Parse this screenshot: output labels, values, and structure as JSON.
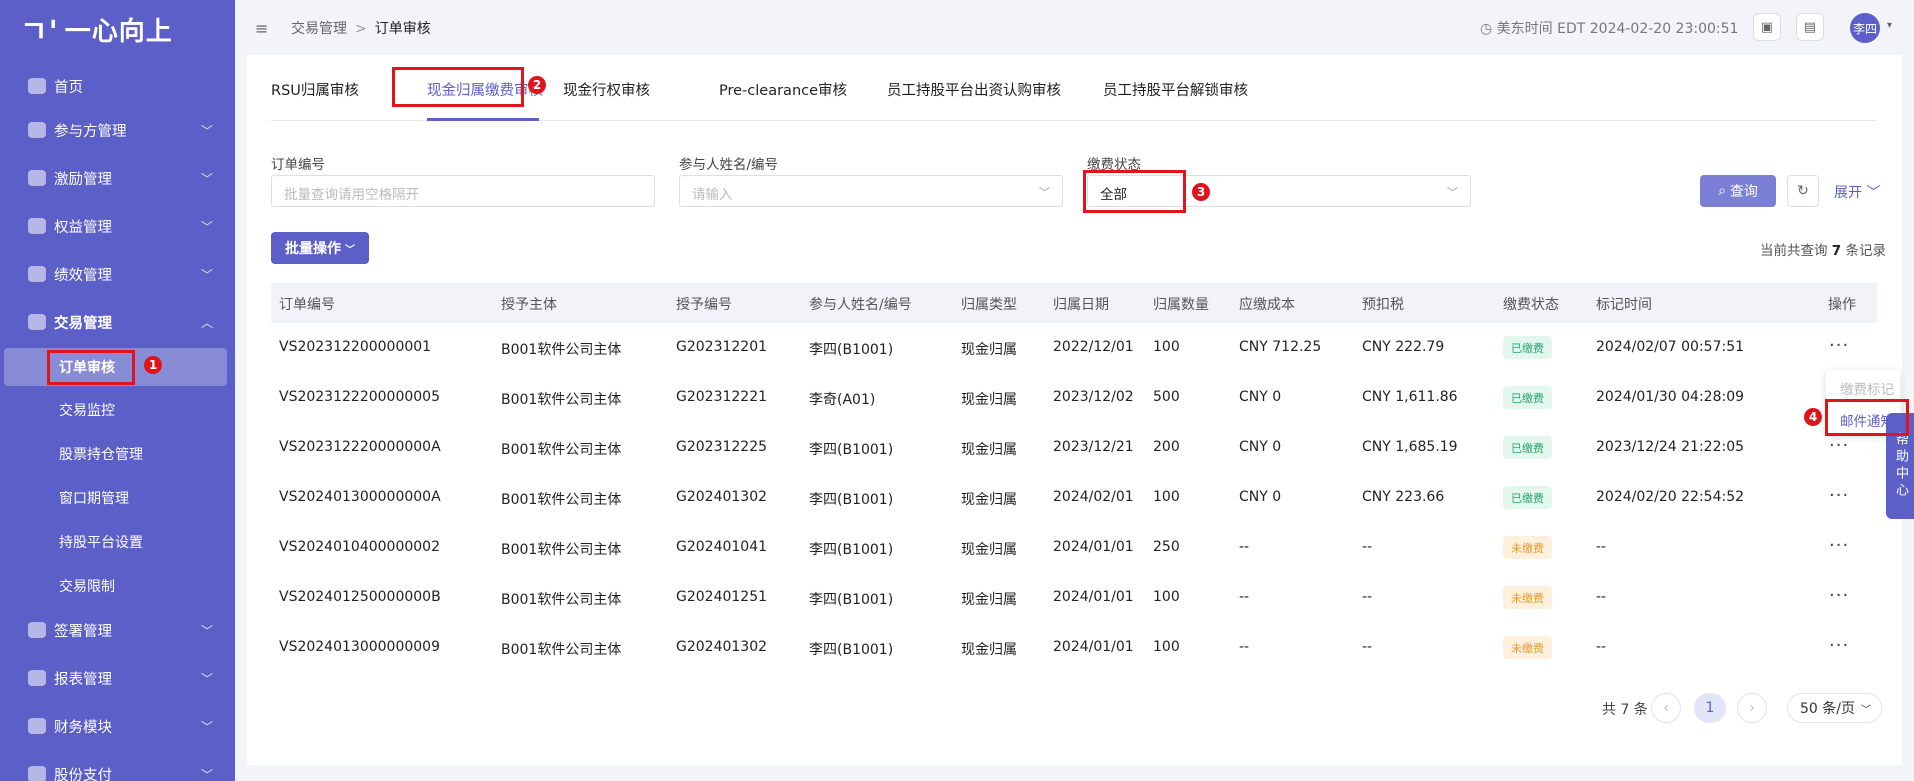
{
  "brand": {
    "logo_text": "一心向上",
    "logo_mark": "ㄱ'"
  },
  "sidebar": {
    "items": [
      {
        "label": "首页",
        "icon": "home-icon",
        "expandable": false
      },
      {
        "label": "参与方管理",
        "icon": "users-icon",
        "expandable": true
      },
      {
        "label": "激励管理",
        "icon": "gift-icon",
        "expandable": true
      },
      {
        "label": "权益管理",
        "icon": "shield-icon",
        "expandable": true
      },
      {
        "label": "绩效管理",
        "icon": "crown-icon",
        "expandable": true
      },
      {
        "label": "交易管理",
        "icon": "shield-check-icon",
        "expandable": true,
        "expanded": true
      },
      {
        "label": "签署管理",
        "icon": "sign-icon",
        "expandable": true
      },
      {
        "label": "报表管理",
        "icon": "report-icon",
        "expandable": true
      },
      {
        "label": "财务模块",
        "icon": "finance-icon",
        "expandable": true
      },
      {
        "label": "股份支付",
        "icon": "payment-icon",
        "expandable": true
      }
    ],
    "sub_items": [
      {
        "label": "订单审核",
        "active": true
      },
      {
        "label": "交易监控"
      },
      {
        "label": "股票持仓管理"
      },
      {
        "label": "窗口期管理"
      },
      {
        "label": "持股平台设置"
      },
      {
        "label": "交易限制"
      }
    ],
    "expand_chevron": "﹀",
    "collapse_chevron": "︿"
  },
  "header": {
    "breadcrumb": [
      "交易管理",
      "订单审核"
    ],
    "breadcrumb_sep": ">",
    "collapse_icon": "≡",
    "time_label": "美东时间 EDT 2024-02-20 23:00:51",
    "user_avatar": "李四"
  },
  "tabs": [
    "RSU归属审核",
    "现金归属缴费审核",
    "现金行权审核",
    "Pre-clearance审核",
    "员工持股平台出资认购审核",
    "员工持股平台解锁审核"
  ],
  "active_tab": 1,
  "filters": {
    "order_no_label": "订单编号",
    "order_no_placeholder": "批量查询请用空格隔开",
    "participant_label": "参与人姓名/编号",
    "participant_placeholder": "请输入",
    "status_label": "缴费状态",
    "status_value": "全部"
  },
  "actions": {
    "query": "查询",
    "expand": "展开",
    "batch": "批量操作",
    "total_prefix": "当前共查询",
    "total_count": "7",
    "total_suffix": "条记录"
  },
  "table": {
    "headers": [
      "订单编号",
      "授予主体",
      "授予编号",
      "参与人姓名/编号",
      "归属类型",
      "归属日期",
      "归属数量",
      "应缴成本",
      "预扣税",
      "缴费状态",
      "标记时间",
      "操作"
    ],
    "rows": [
      [
        "VS202312200000001",
        "B001软件公司主体",
        "G202312201",
        "李四(B1001)",
        "现金归属",
        "2022/12/01",
        "100",
        "CNY 712.25",
        "CNY 222.79",
        "已缴费",
        "2024/02/07 00:57:51"
      ],
      [
        "VS2023122200000005",
        "B001软件公司主体",
        "G202312221",
        "李奇(A01)",
        "现金归属",
        "2023/12/02",
        "500",
        "CNY 0",
        "CNY 1,611.86",
        "已缴费",
        "2024/01/30 04:28:09"
      ],
      [
        "VS202312220000000A",
        "B001软件公司主体",
        "G202312225",
        "李四(B1001)",
        "现金归属",
        "2023/12/21",
        "200",
        "CNY 0",
        "CNY 1,685.19",
        "已缴费",
        "2023/12/24 21:22:05"
      ],
      [
        "VS202401300000000A",
        "B001软件公司主体",
        "G202401302",
        "李四(B1001)",
        "现金归属",
        "2024/02/01",
        "100",
        "CNY 0",
        "CNY 223.66",
        "已缴费",
        "2024/02/20 22:54:52"
      ],
      [
        "VS2024010400000002",
        "B001软件公司主体",
        "G202401041",
        "李四(B1001)",
        "现金归属",
        "2024/01/01",
        "250",
        "--",
        "--",
        "未缴费",
        "--"
      ],
      [
        "VS202401250000000B",
        "B001软件公司主体",
        "G202401251",
        "李四(B1001)",
        "现金归属",
        "2024/01/01",
        "100",
        "--",
        "--",
        "未缴费",
        "--"
      ],
      [
        "VS2024013000000009",
        "B001软件公司主体",
        "G202401302",
        "李四(B1001)",
        "现金归属",
        "2024/01/01",
        "100",
        "--",
        "--",
        "未缴费",
        "--"
      ]
    ],
    "more_label": "···"
  },
  "popup": {
    "item1": "缴费标记",
    "item2": "邮件通知"
  },
  "help_tab": "帮助中心",
  "pagination": {
    "total": "共 7 条",
    "current": "1",
    "page_size": "50 条/页",
    "prev": "‹",
    "next": "›"
  },
  "annotations": [
    "1",
    "2",
    "3",
    "4"
  ],
  "colors": {
    "primary": "#5b5fc7",
    "highlight": "#e0151b",
    "paid": "#2aa56e",
    "unpaid": "#e89a28"
  }
}
